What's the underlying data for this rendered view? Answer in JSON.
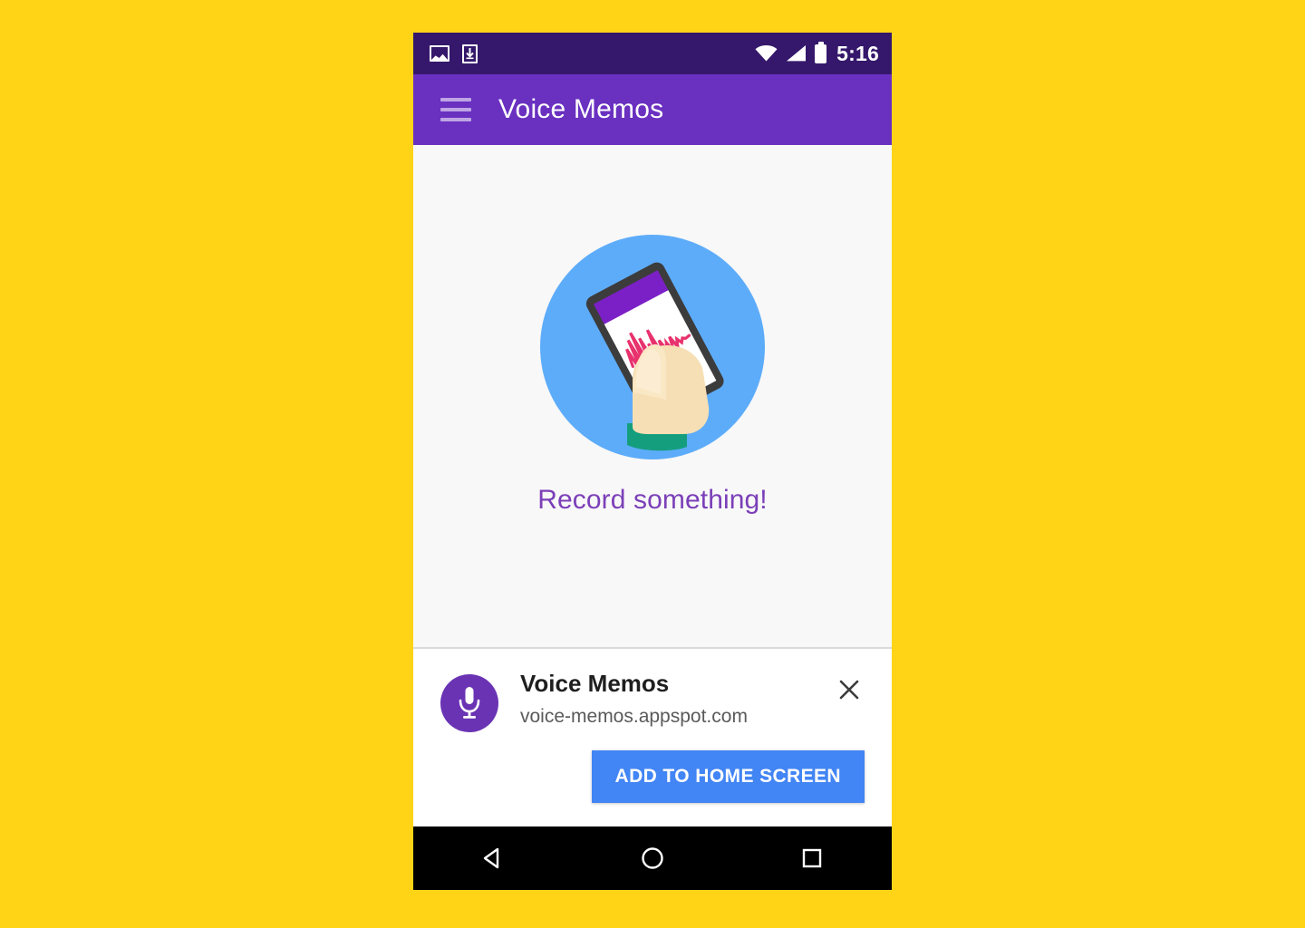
{
  "theme": {
    "page_background": "#FFD417",
    "statusbar_background": "#35186B",
    "appbar_background": "#6A30C0",
    "content_background": "#F8F8F8",
    "accent_purple": "#7B3FB8",
    "install_button_blue": "#4285F4",
    "illustration_circle_blue": "#5DACFA",
    "illustration_sleeve_teal": "#159E7E",
    "illustration_wave_pink": "#E8326D",
    "app_icon_purple": "#6A33B4",
    "navbar_background": "#000000"
  },
  "statusbar": {
    "notifications": [
      {
        "icon": "image-notification-icon"
      },
      {
        "icon": "download-notification-icon"
      }
    ],
    "wifi_icon": "wifi-icon",
    "signal_icon": "cell-signal-icon",
    "battery_icon": "battery-icon",
    "time": "5:16"
  },
  "appbar": {
    "menu_icon": "hamburger-menu-icon",
    "title": "Voice Memos"
  },
  "content": {
    "illustration": "hand-holding-phone-recording-illustration",
    "empty_state_text": "Record something!"
  },
  "install_banner": {
    "app_icon": "microphone-icon",
    "app_name": "Voice Memos",
    "url": "voice-memos.appspot.com",
    "close_icon": "close-icon",
    "install_label": "ADD TO HOME SCREEN"
  },
  "navbar": {
    "back_icon": "back-triangle-icon",
    "home_icon": "home-circle-icon",
    "recents_icon": "recents-square-icon"
  }
}
